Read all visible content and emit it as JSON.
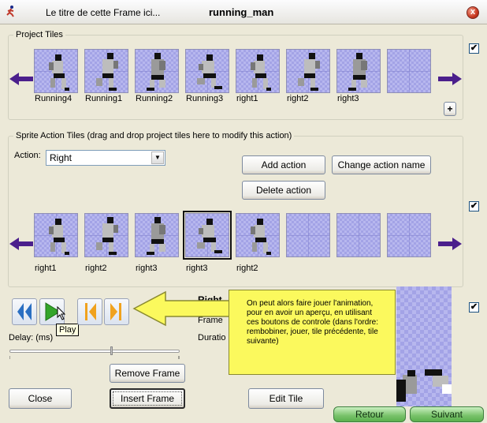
{
  "window": {
    "subtitle": "Le titre de cette Frame ici...",
    "title": "running_man",
    "close_glyph": "x"
  },
  "project_tiles": {
    "label": "Project Tiles",
    "tiles": [
      "Running4",
      "Running1",
      "Running2",
      "Running3",
      "right1",
      "right2",
      "right3",
      ""
    ],
    "add_label": "+",
    "checkbox_checked": true
  },
  "action_tiles": {
    "label": "Sprite Action Tiles (drag and drop project tiles here to modify this action)",
    "action_label": "Action:",
    "action_value": "Right",
    "add_action": "Add action",
    "change_action_name": "Change action name",
    "delete_action": "Delete action",
    "tiles": [
      "right1",
      "right2",
      "right3",
      "right3",
      "right2",
      "",
      "",
      ""
    ],
    "selected_index": 3,
    "checkbox_checked": true
  },
  "player": {
    "rewind_icon": "rewind-icon",
    "play_icon": "play-icon",
    "prev_tile_icon": "previous-tile-icon",
    "next_tile_icon": "next-tile-icon",
    "tooltip": "Play",
    "delay_label": "Delay: (ms)",
    "slider_value": 0.6
  },
  "details": {
    "action_name": "Right",
    "frame_label": "Frame",
    "duration_label": "Duratio",
    "checkbox_checked": true
  },
  "buttons": {
    "remove_frame": "Remove Frame",
    "insert_frame": "Insert Frame",
    "close": "Close",
    "edit_tile": "Edit Tile"
  },
  "callout": {
    "text": "On peut alors faire jouer l'animation, pour en avoir un aperçu, en utilisant ces boutons de controle (dans l'ordre: rembobiner, jouer, tile précédente, tile suivante)"
  },
  "nav": {
    "back": "Retour",
    "next": "Suivant"
  },
  "colors": {
    "arrow": "#4b1f8c",
    "accent_green": "#5ab04d",
    "callout_yellow": "#fbf95d"
  }
}
